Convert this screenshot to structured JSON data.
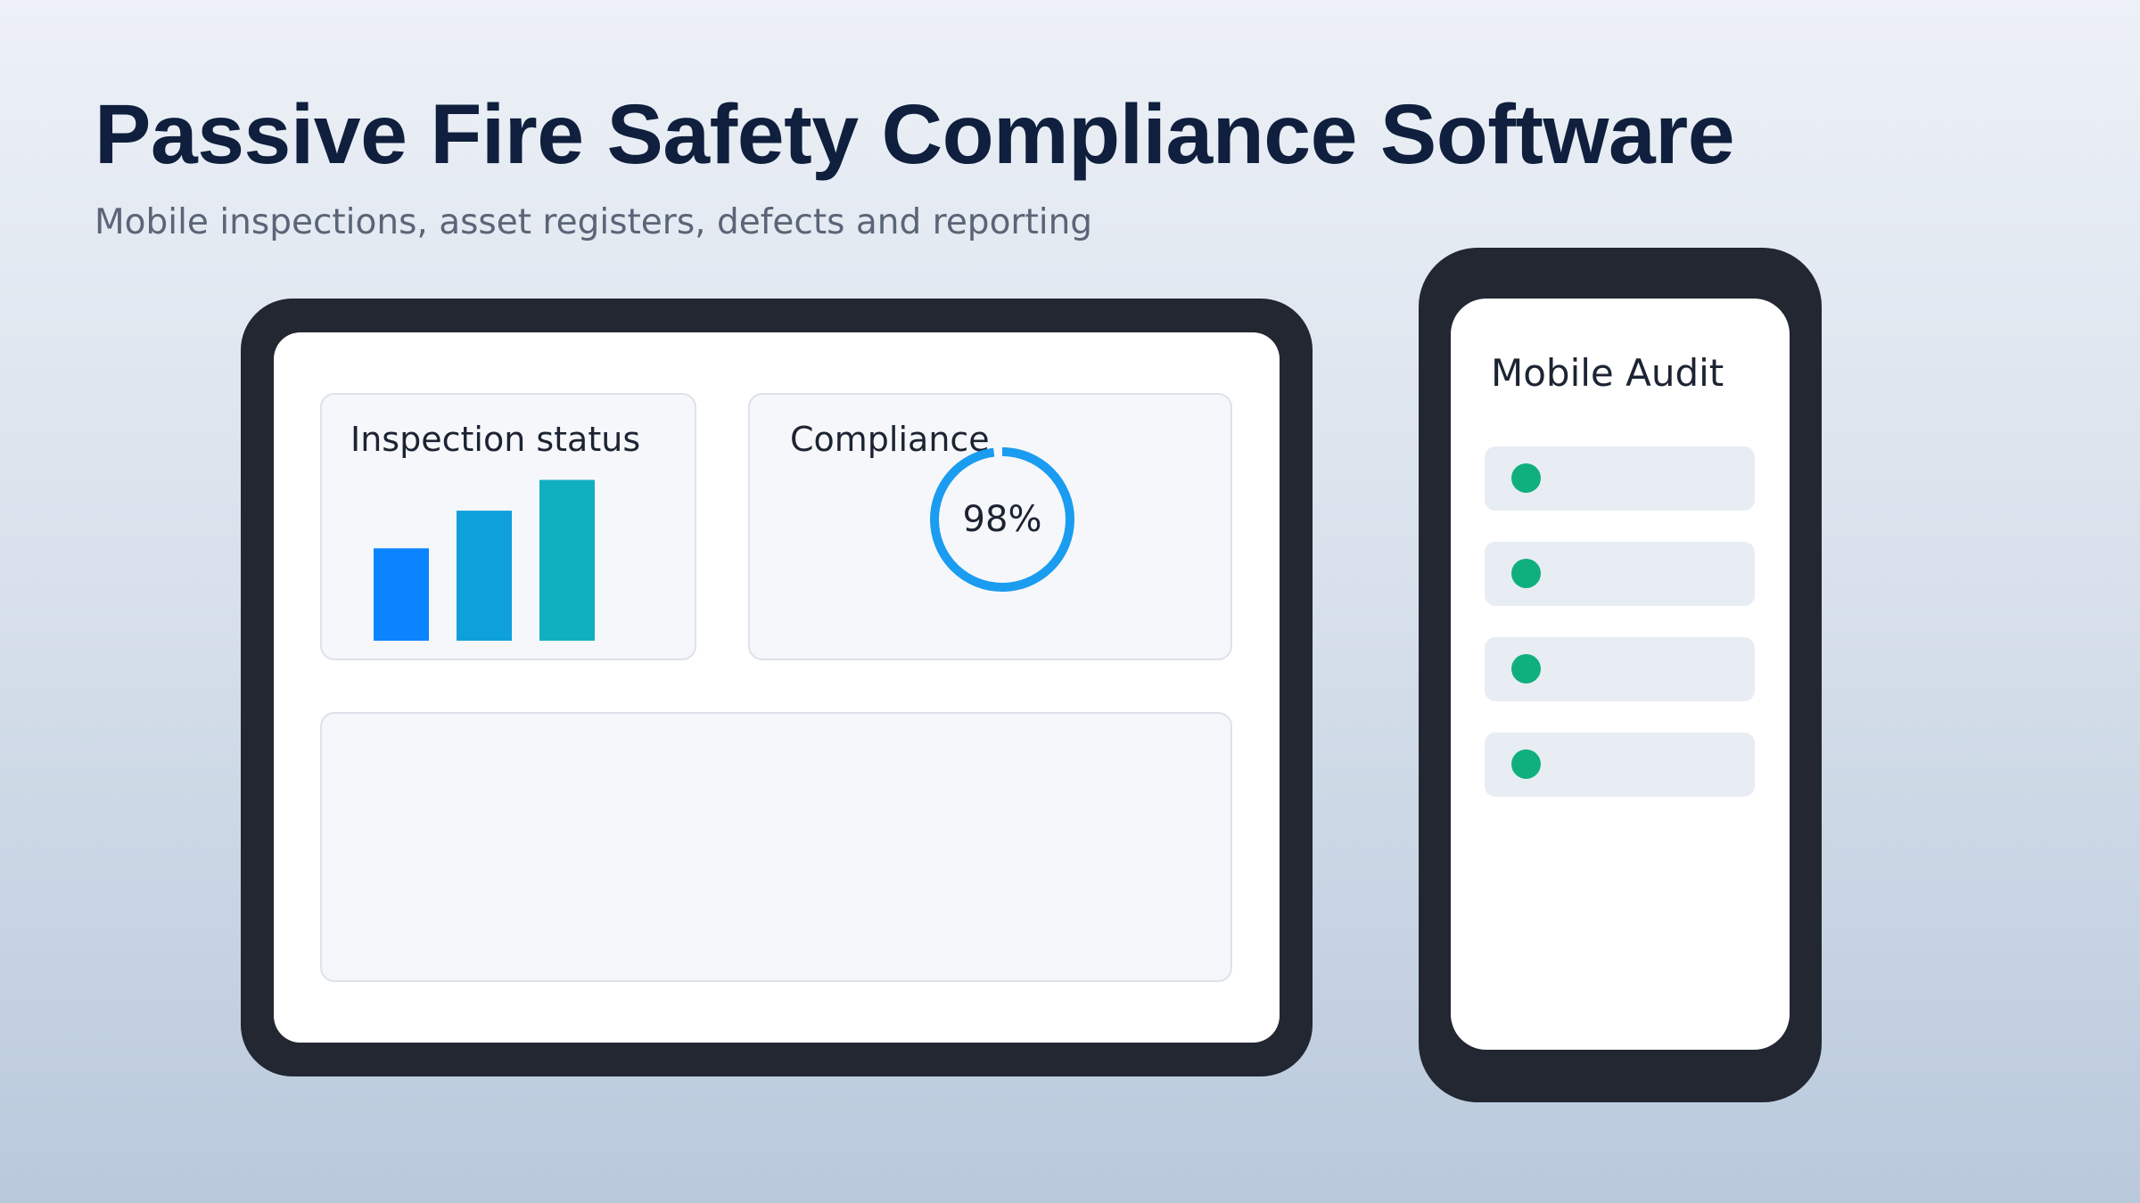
{
  "page": {
    "title": "Passive Fire Safety Compliance Software",
    "subtitle": "Mobile inspections, asset registers, defects and reporting"
  },
  "dashboard": {
    "inspection_card": {
      "title": "Inspection status",
      "bars": [
        {
          "value": 0.54,
          "color": "#0a84ff"
        },
        {
          "value": 0.76,
          "color": "#0ea0db"
        },
        {
          "value": 0.94,
          "color": "#10b0c0"
        }
      ]
    },
    "compliance_card": {
      "title": "Compliance",
      "percent_label": "98%",
      "percent": 98,
      "ring_color": "#1a9cf0"
    }
  },
  "mobile": {
    "title": "Mobile Audit",
    "items": [
      {
        "status_color": "#10b07e"
      },
      {
        "status_color": "#10b07e"
      },
      {
        "status_color": "#10b07e"
      },
      {
        "status_color": "#10b07e"
      }
    ]
  }
}
